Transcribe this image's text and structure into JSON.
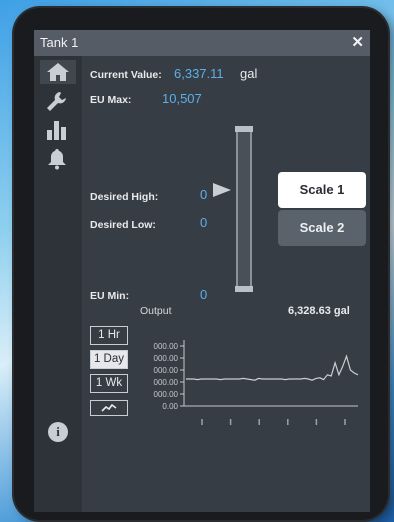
{
  "window": {
    "title": "Tank 1",
    "close_symbol": "✕"
  },
  "sidebar": {
    "items": [
      {
        "icon": "home-icon",
        "active": true
      },
      {
        "icon": "wrench-icon",
        "active": false
      },
      {
        "icon": "bar-chart-icon",
        "active": false
      },
      {
        "icon": "bell-icon",
        "active": false
      },
      {
        "icon": "info-icon",
        "active": false,
        "glyph": "i"
      }
    ]
  },
  "readings": {
    "current_value_label": "Current Value:",
    "current_value": "6,337.11",
    "current_value_unit": "gal",
    "eu_max_label": "EU Max:",
    "eu_max": "10,507",
    "desired_high_label": "Desired High:",
    "desired_high": "0",
    "desired_low_label": "Desired Low:",
    "desired_low": "0",
    "eu_min_label": "EU Min:",
    "eu_min": "0"
  },
  "scale_buttons": {
    "scale1": "Scale 1",
    "scale2": "Scale 2",
    "selected": "Scale 1"
  },
  "trend": {
    "output_label": "Output",
    "output_value": "6,328.63 gal",
    "range_buttons": [
      "1 Hr",
      "1 Day",
      "1 Wk"
    ],
    "selected_range": "1 Day"
  },
  "chart_data": {
    "type": "line",
    "y_tick_labels": [
      "000.00",
      "000.00",
      "000.00",
      "000.00",
      "000.00",
      "0.00"
    ],
    "x_tick_count": 6,
    "series": [
      {
        "values": [
          0.45,
          0.45,
          0.45,
          0.44,
          0.45,
          0.45,
          0.45,
          0.45,
          0.45,
          0.44,
          0.45,
          0.45,
          0.45,
          0.45,
          0.45,
          0.46,
          0.45,
          0.44,
          0.43,
          0.46,
          0.45,
          0.45,
          0.45,
          0.45,
          0.45,
          0.45,
          0.44,
          0.45,
          0.45,
          0.45,
          0.45,
          0.46,
          0.45,
          0.43,
          0.46,
          0.47,
          0.44,
          0.52,
          0.5,
          0.72,
          0.52,
          0.66,
          0.83,
          0.6,
          0.55,
          0.52
        ]
      }
    ]
  }
}
